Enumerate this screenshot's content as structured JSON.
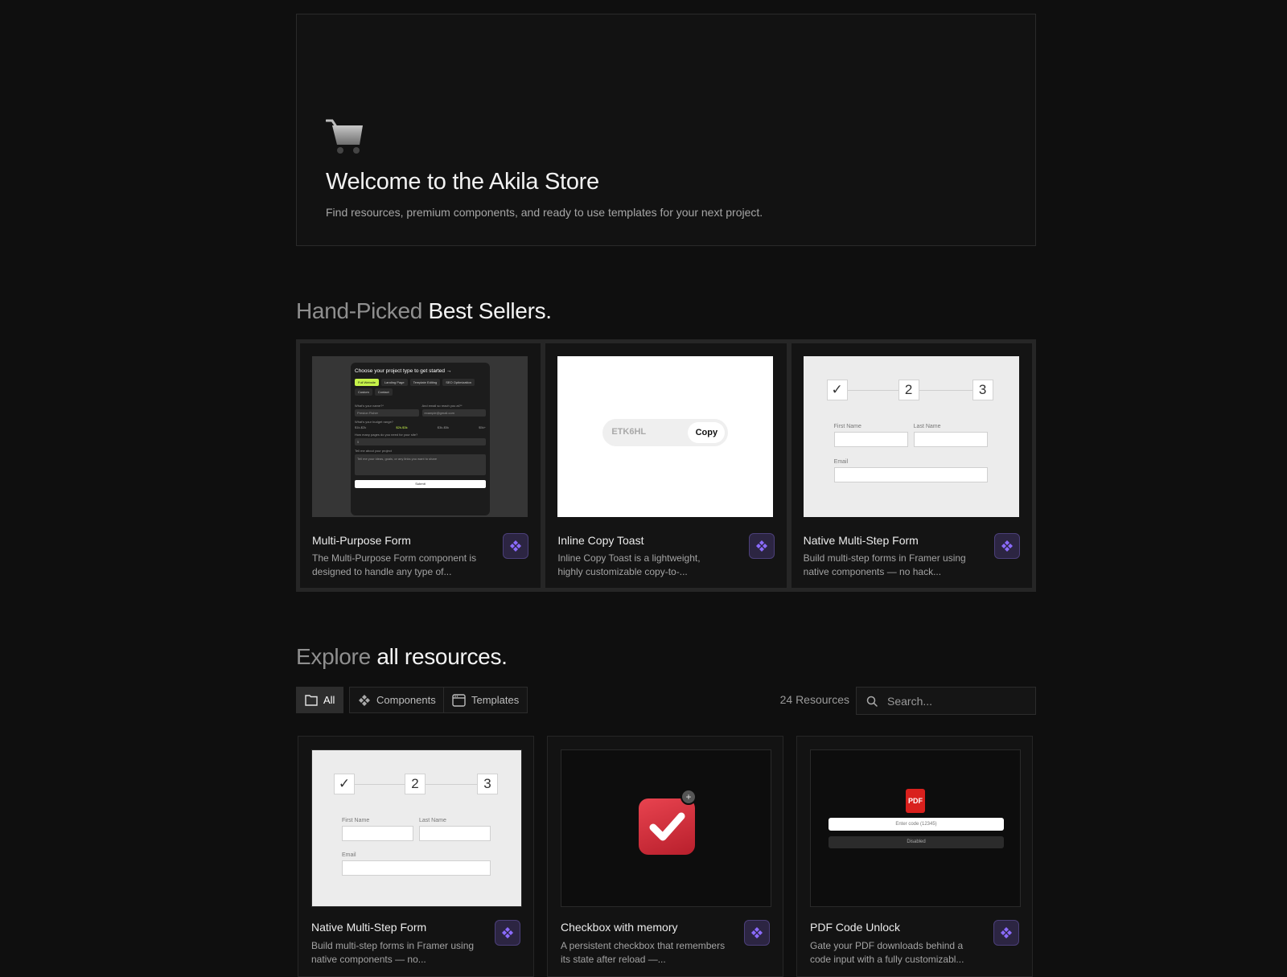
{
  "hero": {
    "title": "Welcome to the Akila Store",
    "subtitle": "Find resources, premium components, and ready to use templates for your next project.",
    "icon": "shopping-cart-icon"
  },
  "best_sellers": {
    "title_dim": "Hand-Picked",
    "title_bright": "Best Sellers.",
    "cards": [
      {
        "title": "Multi-Purpose Form",
        "desc": "The Multi-Purpose Form component is designed to handle any type of...",
        "preview": {
          "heading": "Choose your project type to get started →",
          "chips": [
            "Full Website",
            "Landing Page",
            "Template Editing",
            "SEO Optimization",
            "Custom",
            "Contact"
          ],
          "name_label": "What's your name?*",
          "email_label": "And email so reach you at?*",
          "name_value": "Preston Fisher",
          "email_value": "example@gmail.com",
          "budget_label": "What's your budget range?",
          "budget_options": [
            "$1k-$2k",
            "$2k-$3k",
            "$3k-$5k",
            "$5k+"
          ],
          "pages_label": "How many pages do you need for your site?",
          "pages_value": "5",
          "about_label": "Tell me about your project",
          "about_placeholder": "Tell me your ideas, goals, or any links you want to share",
          "submit": "Submit"
        }
      },
      {
        "title": "Inline Copy Toast",
        "desc": "Inline Copy Toast is a lightweight, highly customizable copy-to-...",
        "preview": {
          "code": "ETK6HL",
          "button": "Copy"
        }
      },
      {
        "title": "Native Multi-Step Form",
        "desc": "Build multi-step forms in Framer using native components — no hack...",
        "preview": {
          "steps": [
            "✓",
            "2",
            "3"
          ],
          "first_name": "First Name",
          "last_name": "Last Name",
          "email": "Email"
        }
      }
    ]
  },
  "explore": {
    "title_dim": "Explore",
    "title_bright": "all resources.",
    "filters": [
      {
        "label": "All",
        "icon": "folder-icon",
        "active": true
      },
      {
        "label": "Components",
        "icon": "components-icon",
        "active": false
      },
      {
        "label": "Templates",
        "icon": "browser-window-icon",
        "active": false
      }
    ],
    "count": "24 Resources",
    "search_placeholder": "Search...",
    "cards": [
      {
        "title": "Native Multi-Step Form",
        "desc": "Build multi-step forms in Framer using native components — no...",
        "preview": {
          "steps": [
            "✓",
            "2",
            "3"
          ],
          "first_name": "First Name",
          "last_name": "Last Name",
          "email": "Email"
        }
      },
      {
        "title": "Checkbox with memory",
        "desc": "A persistent checkbox that remembers its state after reload —...",
        "preview": {
          "badge": "+"
        }
      },
      {
        "title": "PDF Code Unlock",
        "desc": "Gate your PDF downloads behind a code input with a fully customizabl...",
        "preview": {
          "file_label": "PDF",
          "input_placeholder": "Enter code (12345)",
          "button": "Disabled"
        }
      }
    ]
  },
  "colors": {
    "accent": "#7c5cf0",
    "badge_bg": "#2c2542",
    "lime": "#c6f34a"
  }
}
